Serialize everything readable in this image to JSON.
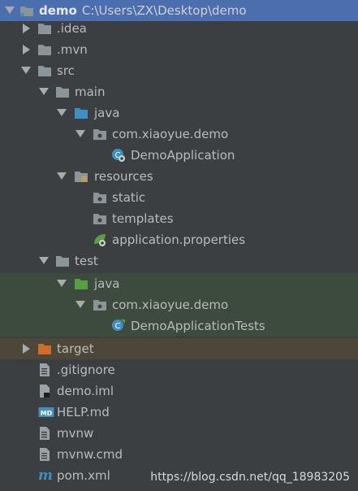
{
  "project": {
    "name": "demo",
    "path": "C:\\Users\\ZX\\Desktop\\demo"
  },
  "tree": {
    "idea": ".idea",
    "mvn": ".mvn",
    "src": "src",
    "main": "main",
    "main_java": "java",
    "main_package": "com.xiaoyue.demo",
    "demo_application": "DemoApplication",
    "resources": "resources",
    "static": "static",
    "templates": "templates",
    "application_properties": "application.properties",
    "test": "test",
    "test_java": "java",
    "test_package": "com.xiaoyue.demo",
    "demo_application_tests": "DemoApplicationTests",
    "target": "target",
    "gitignore": ".gitignore",
    "demo_iml": "demo.iml",
    "help_md": "HELP.md",
    "mvnw": "mvnw",
    "mvnw_cmd": "mvnw.cmd",
    "pom_xml": "pom.xml"
  },
  "watermark": "https://blog.csdn.net/qq_18983205",
  "colors": {
    "background": "#3c3f41",
    "selection": "#4b6eaf",
    "test_highlight": "#3d4a3e",
    "excluded_highlight": "#4d473a",
    "folder": "#8b9499",
    "source_folder": "#3f8fc4",
    "test_folder": "#5a9e43",
    "excluded_folder": "#d4692c"
  }
}
